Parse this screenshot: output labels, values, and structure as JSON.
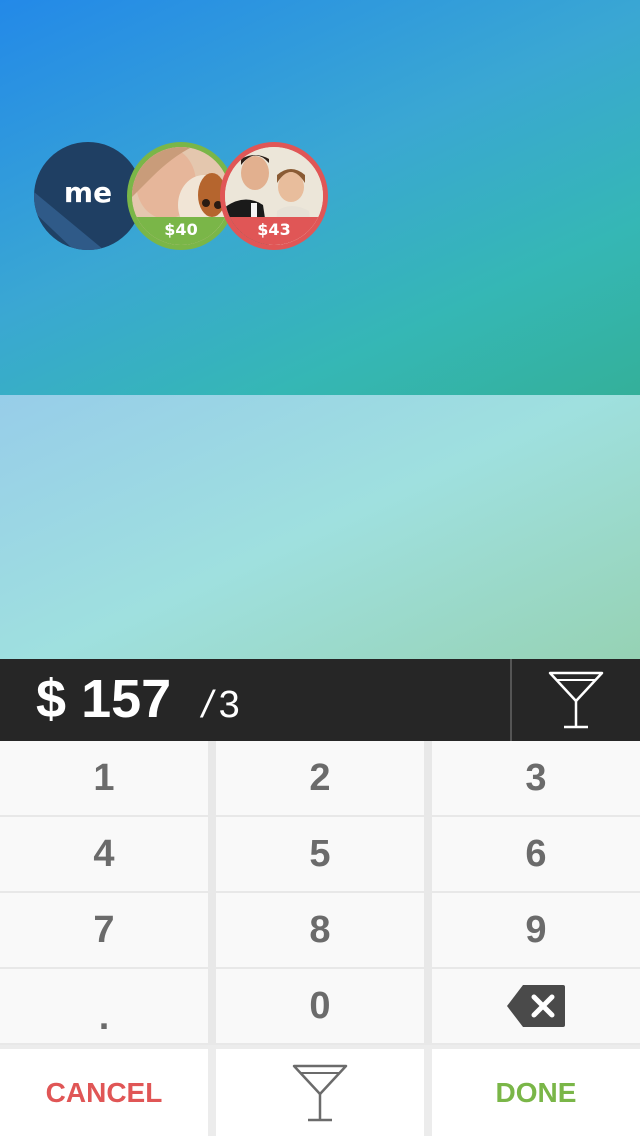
{
  "participants": [
    {
      "label": "me"
    },
    {
      "amount": "$40",
      "ring_color": "#7ab648"
    },
    {
      "amount": "$43",
      "ring_color": "#e05656"
    }
  ],
  "total": {
    "currency": "$",
    "amount": "157",
    "split_symbol": "/",
    "split_count": "3"
  },
  "keypad": {
    "keys": [
      "1",
      "2",
      "3",
      "4",
      "5",
      "6",
      "7",
      "8",
      "9",
      ".",
      "0"
    ],
    "backspace_icon": "backspace-icon"
  },
  "actions": {
    "cancel_label": "CANCEL",
    "tip_icon": "cocktail-glass-icon",
    "done_label": "DONE"
  },
  "colors": {
    "cancel": "#e05656",
    "done": "#7ab648",
    "dark_bar": "#262626"
  }
}
